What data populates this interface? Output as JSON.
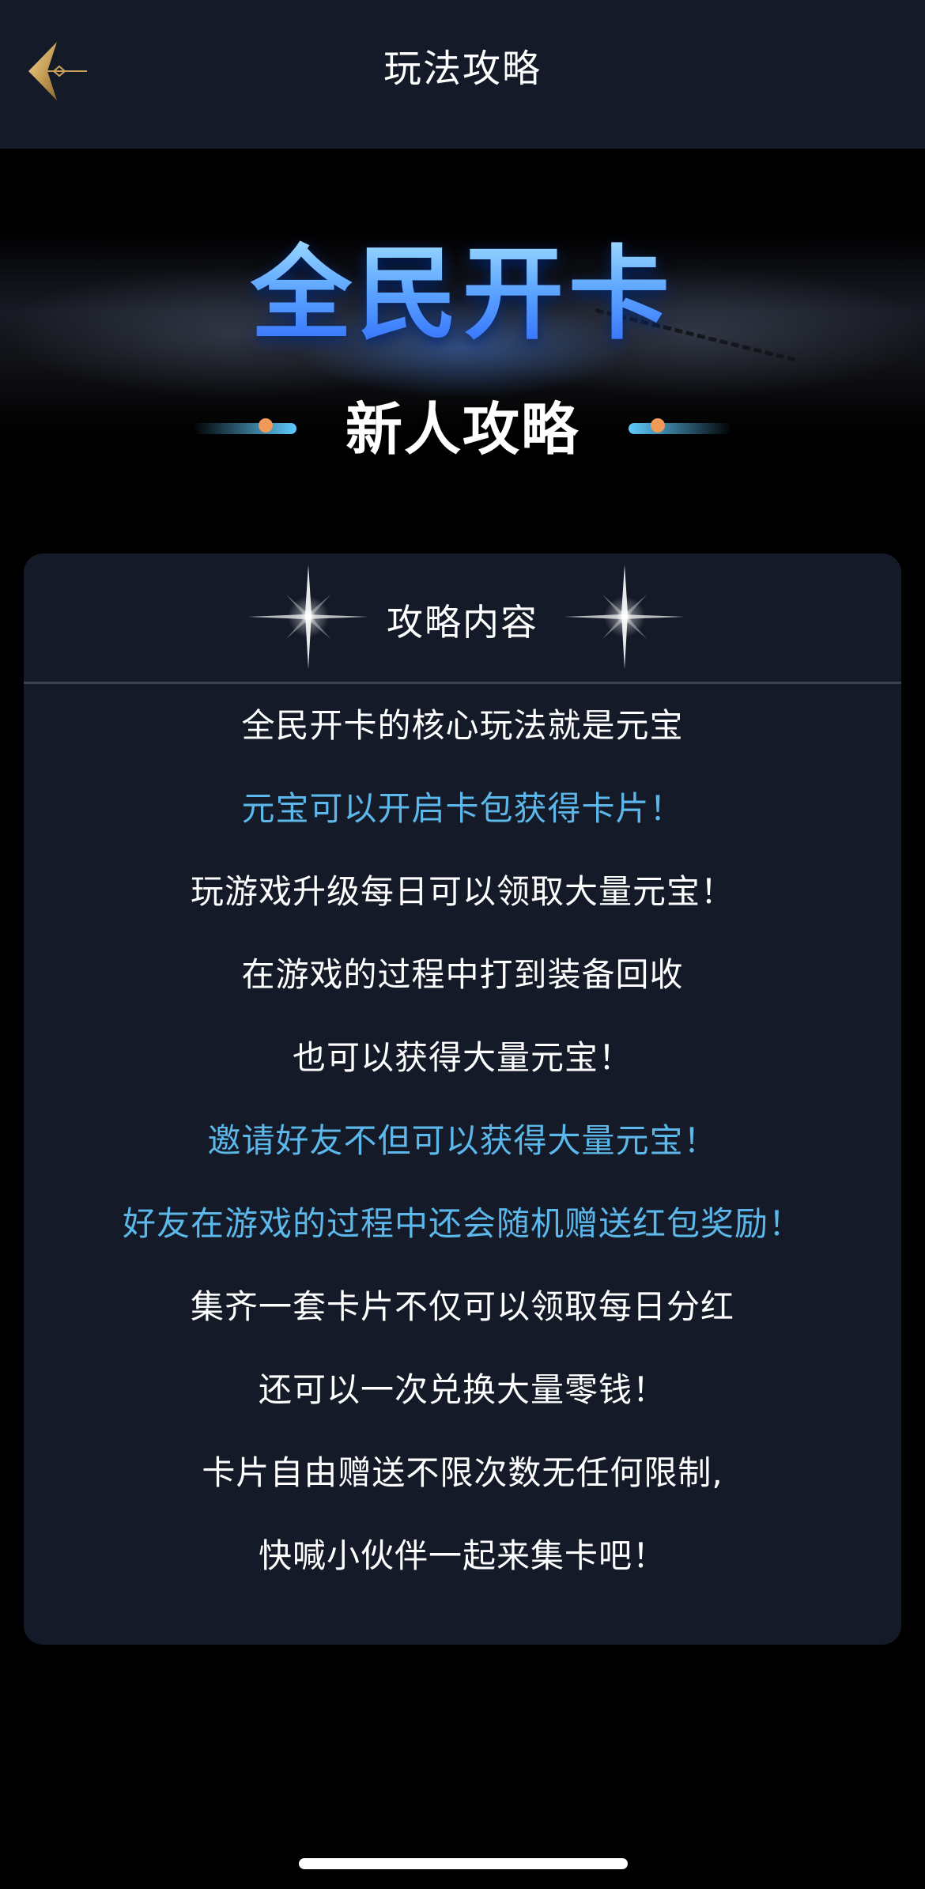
{
  "nav": {
    "title": "玩法攻略",
    "back_icon": "chevron-left-gold-icon"
  },
  "banner": {
    "title": "全民开卡",
    "subtitle": "新人攻略"
  },
  "card": {
    "title": "攻略内容",
    "lines": [
      {
        "text": "全民开卡的核心玩法就是元宝",
        "color": "#ffffff"
      },
      {
        "text": "元宝可以开启卡包获得卡片！",
        "color": "#5cb8ea"
      },
      {
        "text": "玩游戏升级每日可以领取大量元宝！",
        "color": "#ffffff"
      },
      {
        "text": "在游戏的过程中打到装备回收",
        "color": "#ffffff"
      },
      {
        "text": "也可以获得大量元宝！",
        "color": "#ffffff"
      },
      {
        "text": "邀请好友不但可以获得大量元宝！",
        "color": "#5cb8ea"
      },
      {
        "text": "好友在游戏的过程中还会随机赠送红包奖励！",
        "color": "#5cb8ea"
      },
      {
        "text": "集齐一套卡片不仅可以领取每日分红",
        "color": "#ffffff"
      },
      {
        "text": "还可以一次兑换大量零钱！",
        "color": "#ffffff"
      },
      {
        "text": "卡片自由赠送不限次数无任何限制,",
        "color": "#ffffff"
      },
      {
        "text": "快喊小伙伴一起来集卡吧！",
        "color": "#ffffff"
      }
    ]
  },
  "colors": {
    "nav_background": "#141a28",
    "card_background": "#141a28",
    "accent_blue": "#5cb8ea",
    "gold": "#c9a25a"
  }
}
